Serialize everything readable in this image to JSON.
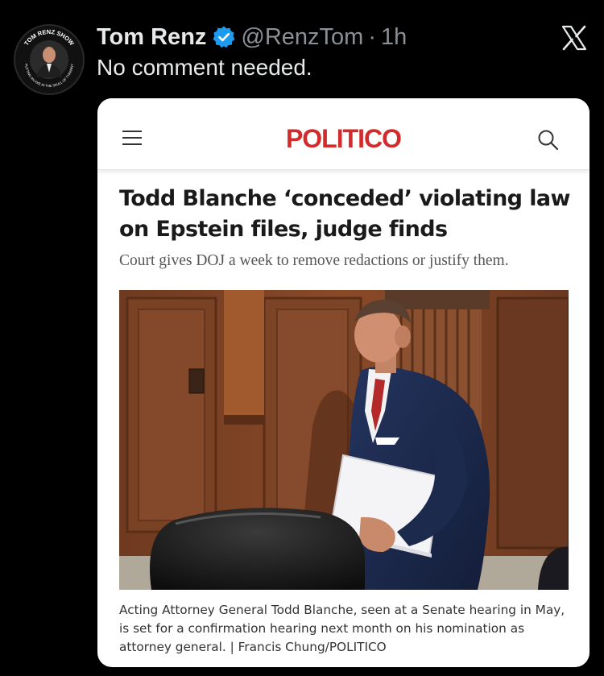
{
  "tweet": {
    "author_name": "Tom Renz",
    "handle": "@RenzTom",
    "separator": "·",
    "time": "1h",
    "text": "No comment needed.",
    "avatar": {
      "ring_top_text": "TOM RENZ SHOW",
      "ring_bottom_text": "PUTTING AN AXE IN THE SKULL OF TYRANNY"
    },
    "verified_icon": "verified-badge-icon",
    "close_icon": "x-logo-icon",
    "accent_color": "#1d9bf0"
  },
  "article": {
    "site_logo": "POLITICO",
    "logo_color": "#d32b2b",
    "menu_icon": "hamburger-menu-icon",
    "search_icon": "search-icon",
    "headline": "Todd Blanche ‘conceded’ violating law on Epstein files, judge finds",
    "subhead": "Court gives DOJ a week to remove redactions or justify them.",
    "photo_icon": "article-photo",
    "caption": "Acting Attorney General Todd Blanche, seen at a Senate hearing in May, is set for a confirmation hearing next month on his nomination as attorney general. | Francis Chung/POLITICO"
  }
}
